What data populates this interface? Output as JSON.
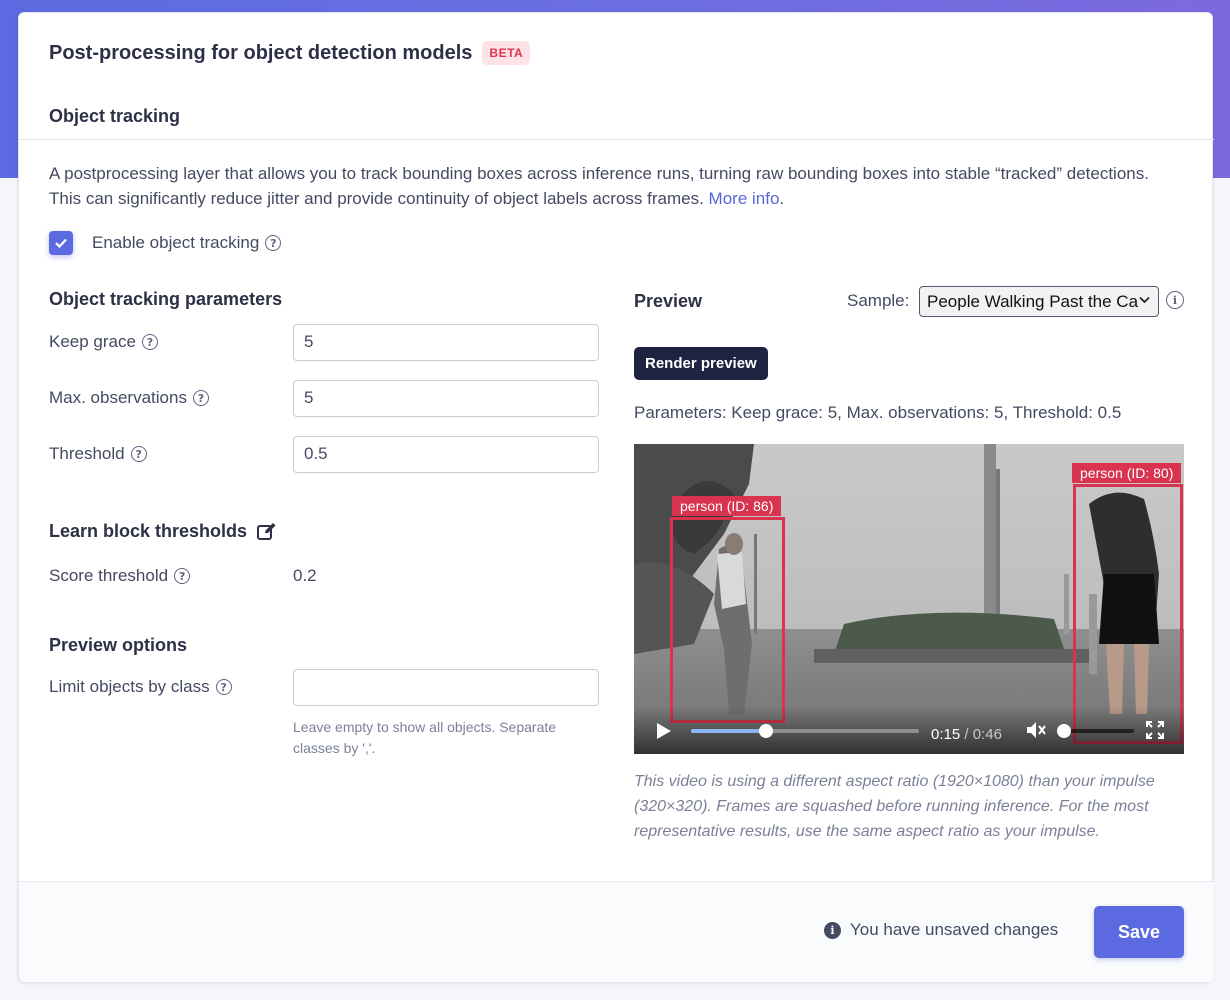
{
  "header": {
    "title": "Post-processing for object detection models",
    "badge": "BETA"
  },
  "tracking": {
    "section_title": "Object tracking",
    "description": "A postprocessing layer that allows you to track bounding boxes across inference runs, turning raw bounding boxes into stable “tracked” detections. This can significantly reduce jitter and provide continuity of object labels across frames. ",
    "more_info_link": "More info",
    "description_end": ".",
    "enable_label": "Enable object tracking",
    "enabled": true
  },
  "params": {
    "title": "Object tracking parameters",
    "keep_grace_label": "Keep grace",
    "keep_grace_value": "5",
    "max_obs_label": "Max. observations",
    "max_obs_value": "5",
    "threshold_label": "Threshold",
    "threshold_value": "0.5"
  },
  "learn_block": {
    "title": "Learn block thresholds",
    "score_label": "Score threshold",
    "score_value": "0.2"
  },
  "preview_options": {
    "title": "Preview options",
    "limit_label": "Limit objects by class",
    "limit_value": "",
    "hint": "Leave empty to show all objects. Separate classes by ','."
  },
  "preview": {
    "title": "Preview",
    "sample_label": "Sample:",
    "sample_value": "People Walking Past the Ca",
    "render_button": "Render preview",
    "params_text": "Parameters: Keep grace: 5, Max. observations: 5, Threshold: 0.5",
    "video": {
      "current_time": "0:15",
      "separator": " / ",
      "duration": "0:46",
      "progress": 0.33,
      "volume": 0.0,
      "detections": [
        {
          "label": "person (ID: 86)"
        },
        {
          "label": "person (ID: 80)"
        }
      ]
    },
    "caption": "This video is using a different aspect ratio (1920×1080) than your impulse (320×320). Frames are squashed before running inference. For the most representative results, use the same aspect ratio as your impulse."
  },
  "footer": {
    "unsaved_text": "You have unsaved changes",
    "save_button": "Save"
  },
  "colors": {
    "accent": "#5b6ae0",
    "badge_bg": "#fde3e6",
    "badge_text": "#e0334d",
    "bbox": "#d8344f",
    "dark_button": "#1d2340"
  },
  "icons": [
    "check-icon",
    "help-circle-icon",
    "edit-icon",
    "info-circle-icon",
    "chevron-down-icon",
    "play-icon",
    "mute-icon",
    "fullscreen-icon"
  ]
}
